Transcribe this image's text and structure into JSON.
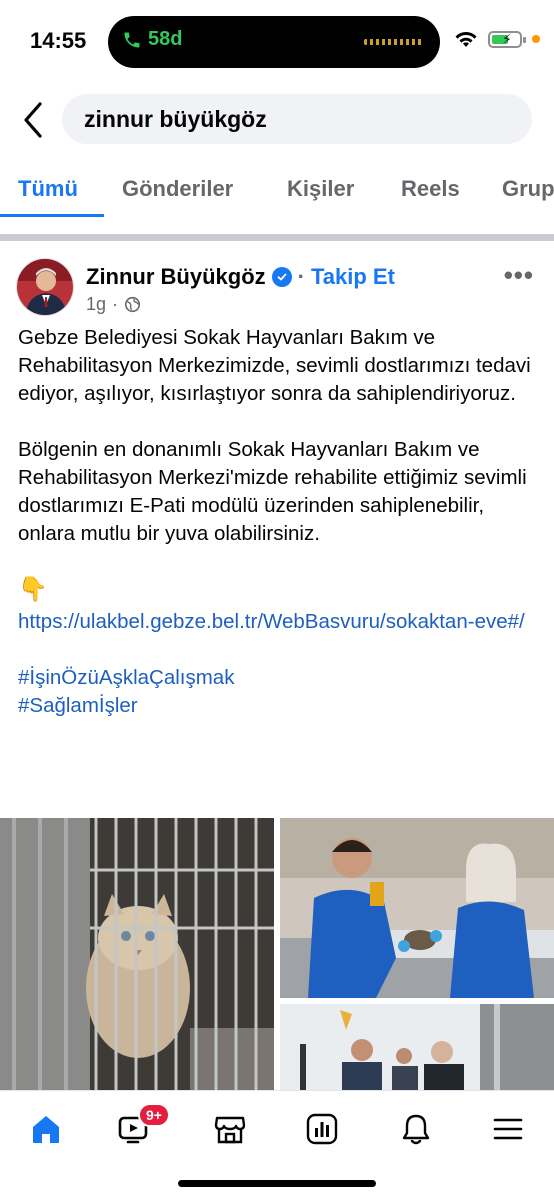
{
  "status_bar": {
    "time": "14:55",
    "call_duration": "58d",
    "accent_green": "#34c759"
  },
  "search": {
    "value": "zinnur büyükgöz",
    "back_icon": "chevron-left-icon"
  },
  "tabs": [
    {
      "label": "Tümü",
      "active": true
    },
    {
      "label": "Gönderiler",
      "active": false
    },
    {
      "label": "Kişiler",
      "active": false
    },
    {
      "label": "Reels",
      "active": false
    },
    {
      "label": "Grup",
      "active": false
    }
  ],
  "post": {
    "author": "Zinnur Büyükgöz",
    "follow_label": "Takip Et",
    "separator": "·",
    "time": "1g",
    "privacy_icon": "globe-icon",
    "more_label": "•••",
    "paragraph1": "Gebze Belediyesi Sokak Hayvanları Bakım ve Rehabilitasyon Merkezimizde, sevimli dostlarımızı tedavi ediyor, aşılıyor, kısırlaştıyor sonra da sahiplendiriyoruz.",
    "paragraph2": "Bölgenin en donanımlı Sokak Hayvanları Bakım ve Rehabilitasyon Merkezi'mizde rehabilite ettiğimiz sevimli dostlarımızı E-Pati modülü üzerinden sahiplenebilir, onlara mutlu bir yuva olabilirsiniz.",
    "emoji": "👇",
    "link": "https://ulakbel.gebze.bel.tr/WebBasvuru/sokaktan-eve#/",
    "hashtags": [
      "#İşinÖzüAşklaÇalışmak",
      "#Sağlamİşler"
    ],
    "link_color": "#1d5fbf"
  },
  "bottom_nav": {
    "items": [
      "home-icon",
      "video-icon",
      "marketplace-icon",
      "dashboard-icon",
      "bell-icon",
      "menu-icon"
    ],
    "video_badge": "9+",
    "accent": "#1877f2"
  }
}
